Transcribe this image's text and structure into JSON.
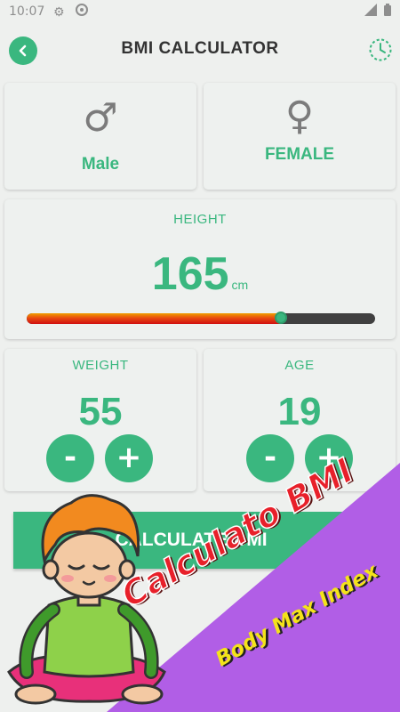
{
  "status_bar": {
    "time": "10:07"
  },
  "app_bar": {
    "title": "BMI CALCULATOR"
  },
  "gender": {
    "male_label": "Male",
    "female_label": "FEMALE",
    "male_symbol": "♂",
    "female_symbol": "♀"
  },
  "height": {
    "label": "HEIGHT",
    "value": "165",
    "unit": "cm",
    "slider_fraction": 0.73
  },
  "weight": {
    "label": "WEIGHT",
    "value": "55",
    "minus": "-",
    "plus": "+"
  },
  "age": {
    "label": "AGE",
    "value": "19",
    "minus": "-",
    "plus": "+"
  },
  "calculate_button": {
    "label": "CALCULATE BMI"
  },
  "promo": {
    "line1": "Calculato BMI",
    "line2": "Body Max Index"
  },
  "colors": {
    "accent": "#3ab77f",
    "promo_purple": "#b15ee6"
  },
  "icons": {
    "back": "back-arrow-icon",
    "history": "history-clock-icon",
    "settings": "gear-icon",
    "sync": "sync-icon",
    "signal": "signal-icon",
    "battery": "battery-icon"
  }
}
